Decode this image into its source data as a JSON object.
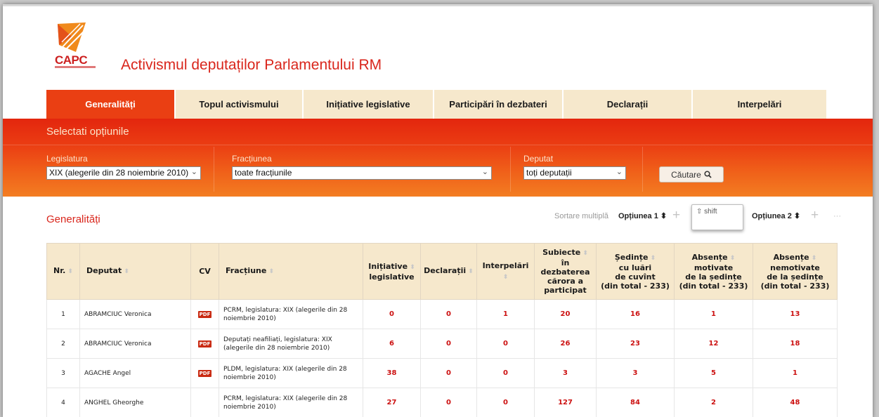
{
  "logo": {
    "text": "CAPC"
  },
  "site_title": "Activismul deputaților Parlamentului RM",
  "tabs": [
    {
      "label": "Generalități",
      "active": true
    },
    {
      "label": "Topul activismului",
      "active": false
    },
    {
      "label": "Inițiative legislative",
      "active": false
    },
    {
      "label": "Participări în dezbateri",
      "active": false
    },
    {
      "label": "Declarații",
      "active": false
    },
    {
      "label": "Interpelări",
      "active": false
    }
  ],
  "filters": {
    "title": "Selectati opțiunile",
    "legislatura": {
      "label": "Legislatura",
      "value": "XIX (alegerile din 28 noiembrie 2010)"
    },
    "fractiunea": {
      "label": "Fracțiunea",
      "value": "toate fracțiunile"
    },
    "deputat": {
      "label": "Deputat",
      "value": "toți deputații"
    },
    "search_label": "Căutare"
  },
  "section": {
    "title": "Generalități",
    "sort_label": "Sortare multiplă",
    "option1": "Opțiunea 1",
    "option2": "Opțiunea 2",
    "shift_hint": "⇧ shift",
    "dots": "···"
  },
  "table": {
    "headers": [
      [
        "Nr."
      ],
      [
        "Deputat"
      ],
      [
        "CV"
      ],
      [
        "Fracțiune"
      ],
      [
        "Inițiative",
        "legislative"
      ],
      [
        "Declarații"
      ],
      [
        "Interpelări"
      ],
      [
        "Subiecte",
        "în dezbaterea",
        "cărora a",
        "participat"
      ],
      [
        "Ședințe",
        "cu luări",
        "de cuvînt",
        "(din total - 233)"
      ],
      [
        "Absențe",
        "motivate",
        "de la ședințe",
        "(din total - 233)"
      ],
      [
        "Absențe",
        "nemotivate",
        "de la ședințe",
        "(din total - 233)"
      ]
    ],
    "pdf_label": "PDF",
    "rows": [
      {
        "nr": "1",
        "deputat": "ABRAMCIUC Veronica",
        "cv": true,
        "fractiune": "PCRM, legislatura: XIX (alegerile din 28 noiembrie 2010)",
        "initiative": "0",
        "declaratii": "0",
        "interpelari": "1",
        "subiecte": "20",
        "sedinte": "16",
        "abs_motivate": "1",
        "abs_nemotivate": "13"
      },
      {
        "nr": "2",
        "deputat": "ABRAMCIUC Veronica",
        "cv": true,
        "fractiune": "Deputați neafiliați, legislatura: XIX (alegerile din 28 noiembrie 2010)",
        "initiative": "6",
        "declaratii": "0",
        "interpelari": "0",
        "subiecte": "26",
        "sedinte": "23",
        "abs_motivate": "12",
        "abs_nemotivate": "18"
      },
      {
        "nr": "3",
        "deputat": "AGACHE Angel",
        "cv": true,
        "fractiune": "PLDM, legislatura: XIX (alegerile din 28 noiembrie 2010)",
        "initiative": "38",
        "declaratii": "0",
        "interpelari": "0",
        "subiecte": "3",
        "sedinte": "3",
        "abs_motivate": "5",
        "abs_nemotivate": "1"
      },
      {
        "nr": "4",
        "deputat": "ANGHEL Gheorghe",
        "cv": false,
        "fractiune": "PCRM, legislatura: XIX (alegerile din 28 noiembrie 2010)",
        "initiative": "27",
        "declaratii": "0",
        "interpelari": "0",
        "subiecte": "127",
        "sedinte": "84",
        "abs_motivate": "2",
        "abs_nemotivate": "48"
      }
    ]
  },
  "colors": {
    "accent": "#d9261c",
    "tab_bg": "#f6e8cc",
    "tab_active": "#ea3f13",
    "value_red": "#cc1111"
  }
}
